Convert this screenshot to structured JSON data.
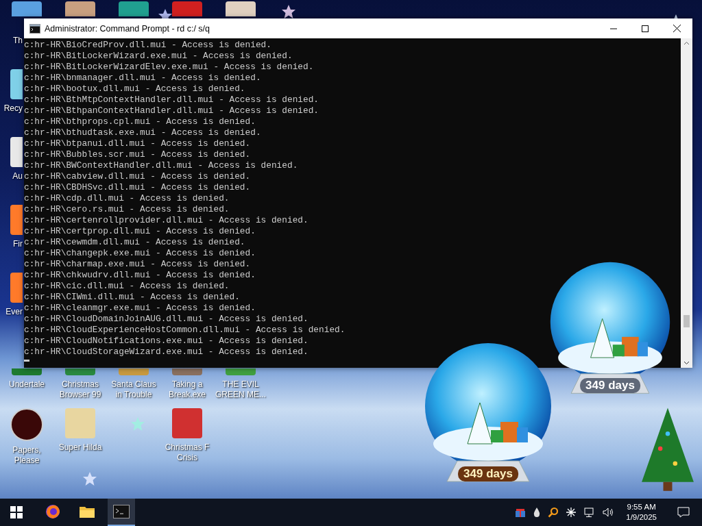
{
  "desktop_icons": [
    {
      "label": "Th"
    },
    {
      "label": "Recy"
    },
    {
      "label": "Au"
    },
    {
      "label": "Fir"
    },
    {
      "label": "Ever"
    },
    {
      "label": "Undertale"
    },
    {
      "label": "Papers, Please"
    },
    {
      "label": "Christmas Browser 99"
    },
    {
      "label": "Super Hilda"
    },
    {
      "label": "Santa Claus in Trouble"
    },
    {
      "label": "Taking a Break.exe"
    },
    {
      "label": "Christmas F Crisis"
    },
    {
      "label": "THE EVIL GREEN ME..."
    }
  ],
  "window": {
    "title": "Administrator: Command Prompt - rd  c:/ s/q",
    "lines": [
      "c:hr-HR\\BioCredProv.dll.mui - Access is denied.",
      "c:hr-HR\\BitLockerWizard.exe.mui - Access is denied.",
      "c:hr-HR\\BitLockerWizardElev.exe.mui - Access is denied.",
      "c:hr-HR\\bnmanager.dll.mui - Access is denied.",
      "c:hr-HR\\bootux.dll.mui - Access is denied.",
      "c:hr-HR\\BthMtpContextHandler.dll.mui - Access is denied.",
      "c:hr-HR\\BthpanContextHandler.dll.mui - Access is denied.",
      "c:hr-HR\\bthprops.cpl.mui - Access is denied.",
      "c:hr-HR\\bthudtask.exe.mui - Access is denied.",
      "c:hr-HR\\btpanui.dll.mui - Access is denied.",
      "c:hr-HR\\Bubbles.scr.mui - Access is denied.",
      "c:hr-HR\\BWContextHandler.dll.mui - Access is denied.",
      "c:hr-HR\\cabview.dll.mui - Access is denied.",
      "c:hr-HR\\CBDHSvc.dll.mui - Access is denied.",
      "c:hr-HR\\cdp.dll.mui - Access is denied.",
      "c:hr-HR\\cero.rs.mui - Access is denied.",
      "c:hr-HR\\certenrollprovider.dll.mui - Access is denied.",
      "c:hr-HR\\certprop.dll.mui - Access is denied.",
      "c:hr-HR\\cewmdm.dll.mui - Access is denied.",
      "c:hr-HR\\changepk.exe.mui - Access is denied.",
      "c:hr-HR\\charmap.exe.mui - Access is denied.",
      "c:hr-HR\\chkwudrv.dll.mui - Access is denied.",
      "c:hr-HR\\cic.dll.mui - Access is denied.",
      "c:hr-HR\\CIWmi.dll.mui - Access is denied.",
      "c:hr-HR\\cleanmgr.exe.mui - Access is denied.",
      "c:hr-HR\\CloudDomainJoinAUG.dll.mui - Access is denied.",
      "c:hr-HR\\CloudExperienceHostCommon.dll.mui - Access is denied.",
      "c:hr-HR\\CloudNotifications.exe.mui - Access is denied.",
      "c:hr-HR\\CloudStorageWizard.exe.mui - Access is denied."
    ]
  },
  "gadgets": [
    {
      "counter": "349 days"
    },
    {
      "counter": "349 days"
    }
  ],
  "taskbar": {
    "apps": [
      {
        "kind": "browser",
        "selected": false
      },
      {
        "kind": "folder",
        "selected": false
      },
      {
        "kind": "terminal",
        "selected": true
      }
    ],
    "time": "9:55 AM",
    "date": "1/9/2025"
  }
}
